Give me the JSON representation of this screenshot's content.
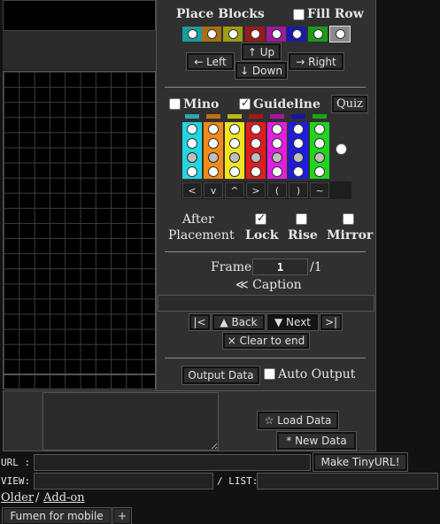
{
  "place_blocks": {
    "title": "Place Blocks",
    "fill_row_label": "Fill Row",
    "colors": [
      {
        "name": "I",
        "hex": "#1a9c9c"
      },
      {
        "name": "L",
        "hex": "#a86f15"
      },
      {
        "name": "O",
        "hex": "#9c9c15"
      },
      {
        "name": "Z",
        "hex": "#9c1a1a"
      },
      {
        "name": "T",
        "hex": "#9c1a9c"
      },
      {
        "name": "J",
        "hex": "#1a1aa8"
      },
      {
        "name": "S",
        "hex": "#1a9c1a"
      },
      {
        "name": "Gray",
        "hex": "#8a8a8a"
      }
    ],
    "up": "↑ Up",
    "left": "← Left",
    "down": "↓ Down",
    "right": "→ Right"
  },
  "mino": {
    "mino_label": "Mino",
    "guideline_label": "Guideline",
    "quiz": "Quiz",
    "columns": [
      {
        "piece": "I",
        "hex": "#24d6e0",
        "cap": "#2ba7b0"
      },
      {
        "piece": "L",
        "hex": "#f08a18",
        "cap": "#c56f10"
      },
      {
        "piece": "O",
        "hex": "#f0e320",
        "cap": "#c2b715"
      },
      {
        "piece": "Z",
        "hex": "#e11c1c",
        "cap": "#b01515"
      },
      {
        "piece": "T",
        "hex": "#e020e0",
        "cap": "#b010b0"
      },
      {
        "piece": "J",
        "hex": "#1c1ce0",
        "cap": "#1414b0"
      },
      {
        "piece": "S",
        "hex": "#20d420",
        "cap": "#15a815"
      }
    ],
    "keys": [
      "<",
      "v",
      "^",
      ">",
      "(",
      ")",
      "~"
    ]
  },
  "after_placement": {
    "label_line1": "After",
    "label_line2": "Placement",
    "lock": "Lock",
    "rise": "Rise",
    "mirror": "Mirror"
  },
  "frame": {
    "label": "Frame",
    "value": "1",
    "total": "/1",
    "caption": "≪ Caption"
  },
  "nav": {
    "first": "|<",
    "back": "▲ Back",
    "next": "▼ Next",
    "last": ">|",
    "clear": "× Clear to end"
  },
  "output": {
    "output_data": "Output Data",
    "auto_output": "Auto Output"
  },
  "data": {
    "load": "☆ Load Data",
    "new": "*  New Data"
  },
  "links": {
    "url_label": "URL :",
    "tinyurl": "Make TinyURL!",
    "view_label": "VIEW:",
    "list_sep": "/ LIST:",
    "older": "Older",
    "slash": "/",
    "addon": "Add-on",
    "mobile": "Fumen for mobile",
    "plus": "+"
  }
}
